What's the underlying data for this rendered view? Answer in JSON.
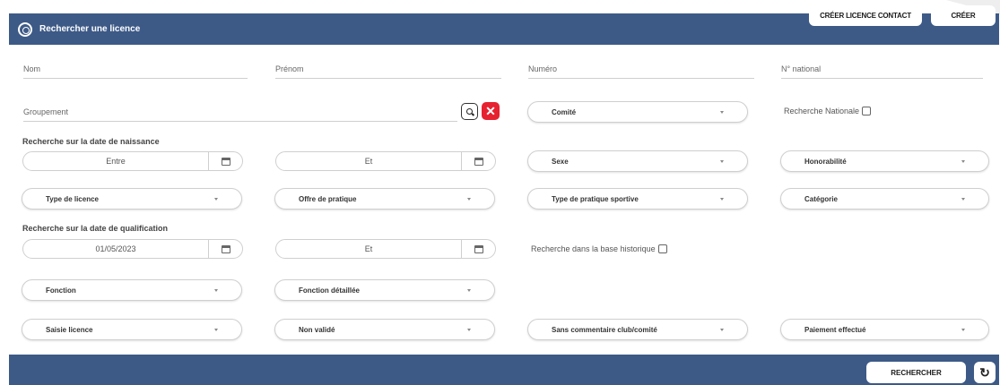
{
  "header": {
    "title": "Rechercher une licence",
    "btn_contact": "CRÉER LICENCE CONTACT",
    "btn_create": "CRÉER"
  },
  "fields": {
    "nom": "Nom",
    "prenom": "Prénom",
    "numero": "Numéro",
    "national": "N° national",
    "groupement": "Groupement"
  },
  "selects": {
    "comite": "Comité",
    "sexe": "Sexe",
    "honorabilite": "Honorabilité",
    "type_licence": "Type de licence",
    "offre": "Offre de pratique",
    "type_pratique": "Type de pratique sportive",
    "categorie": "Catégorie",
    "fonction": "Fonction",
    "fonction_detail": "Fonction détaillée",
    "saisie": "Saisie licence",
    "non_valide": "Non validé",
    "sans_commentaire": "Sans commentaire club/comité",
    "paiement": "Paiement effectué"
  },
  "checkboxes": {
    "nationale": "Recherche Nationale",
    "historique": "Recherche dans la base historique"
  },
  "sections": {
    "naissance": "Recherche sur la date de naissance",
    "qualification": "Recherche sur la date de qualification"
  },
  "dates": {
    "naissance_from": "Entre",
    "naissance_to": "Et",
    "qualif_from": "01/05/2023",
    "qualif_to": "Et"
  },
  "footer": {
    "search": "RECHERCHER",
    "refresh_icon": "refresh-icon"
  },
  "colors": {
    "header": "#3d5a87",
    "clear_button": "#e62230"
  }
}
